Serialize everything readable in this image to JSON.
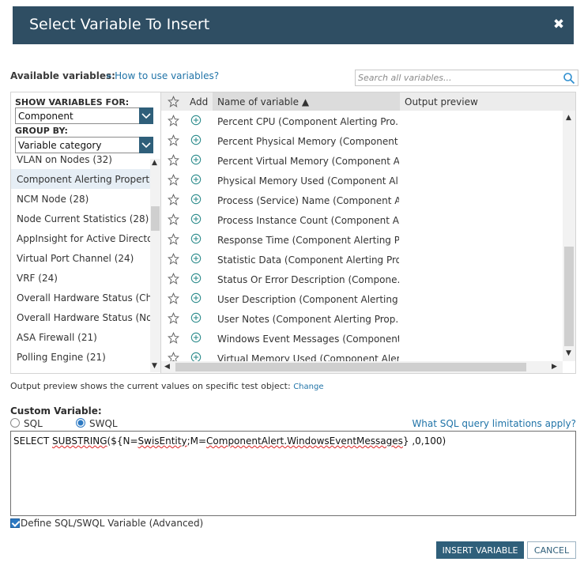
{
  "dialog": {
    "title": "Select Variable To Insert",
    "close_symbol": "✖"
  },
  "available": {
    "label": "Available variables:",
    "help_link": "» How to use variables?",
    "search_placeholder": "Search all variables..."
  },
  "filters": {
    "show_for_label": "SHOW VARIABLES FOR:",
    "show_for_value": "Component",
    "group_by_label": "GROUP BY:",
    "group_by_value": "Variable category"
  },
  "categories": [
    {
      "label": "VLAN on Nodes (32)",
      "selected": false
    },
    {
      "label": "Component Alerting Properti...",
      "selected": true
    },
    {
      "label": "NCM Node (28)",
      "selected": false
    },
    {
      "label": "Node Current Statistics (28)",
      "selected": false
    },
    {
      "label": "AppInsight for Active Director...",
      "selected": false
    },
    {
      "label": "Virtual Port Channel (24)",
      "selected": false
    },
    {
      "label": "VRF (24)",
      "selected": false
    },
    {
      "label": "Overall Hardware Status (Cha...",
      "selected": false
    },
    {
      "label": "Overall Hardware Status (Nod...",
      "selected": false
    },
    {
      "label": "ASA Firewall (21)",
      "selected": false
    },
    {
      "label": "Polling Engine (21)",
      "selected": false
    }
  ],
  "table": {
    "col_add": "Add",
    "col_name": "Name of variable ▲",
    "col_preview": "Output preview",
    "rows": [
      "Percent CPU (Component Alerting Pro...",
      "Percent Physical Memory (Component ...",
      "Percent Virtual Memory (Component A...",
      "Physical Memory Used (Component Al...",
      "Process (Service) Name (Component Al...",
      "Process Instance Count (Component Al...",
      "Response Time (Component Alerting P...",
      "Statistic Data (Component Alerting Pro...",
      "Status Or Error Description (Compone...",
      "User Description (Component Alerting ...",
      "User Notes (Component Alerting Prop...",
      "Windows Event Messages (Component...",
      "Virtual Memory Used (Component Aler..."
    ]
  },
  "preview_note": {
    "text": "Output preview shows the current values on specific test object:",
    "link": "Change"
  },
  "custom": {
    "label": "Custom Variable:",
    "option_sql": "SQL",
    "option_swql": "SWQL",
    "selected_option": "SWQL",
    "limits_link": "What SQL query limitations apply?",
    "query_parts": {
      "p1": "SELECT ",
      "p2": "SUBSTRING",
      "p3": "(${N=",
      "p4": "SwisEntity",
      "p5": ";M=",
      "p6": "ComponentAlert.WindowsEventMessages",
      "p7": "} ,0,100)"
    },
    "define_label": "Define SQL/SWQL Variable (Advanced)",
    "define_checked": true
  },
  "buttons": {
    "insert": "INSERT VARIABLE",
    "cancel": "CANCEL"
  },
  "colors": {
    "header_bg": "#2f4e63",
    "primary_button": "#2f5f7a",
    "link": "#2174a8"
  }
}
